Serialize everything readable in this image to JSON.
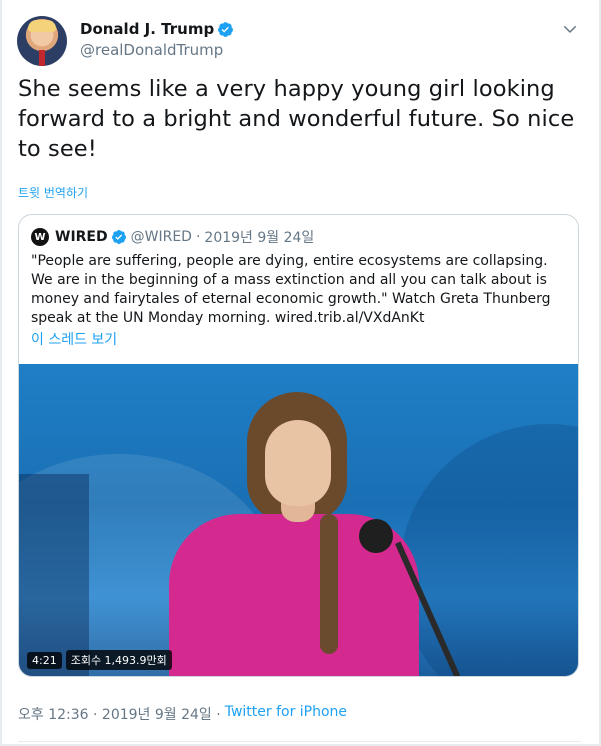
{
  "author": {
    "display_name": "Donald J. Trump",
    "handle": "@realDonaldTrump"
  },
  "tweet": {
    "text": "She seems like a very happy young girl looking forward to a bright and wonderful future. So nice to see!",
    "translate_link": "트윗 번역하기"
  },
  "quote": {
    "name": "WIRED",
    "handle": "@WIRED",
    "separator": "·",
    "date": "2019년 9월 24일",
    "body": "\"People are suffering, people are dying, entire ecosystems are collapsing. We are in the beginning of a mass extinction and all you can talk about is money and fairytales of eternal economic growth.\" Watch Greta Thunberg speak at the UN Monday morning. wired.trib.al/VXdAnKt",
    "thread_link": "이 스레드 보기",
    "video": {
      "duration": "4:21",
      "views": "조회수 1,493.9만회"
    }
  },
  "meta": {
    "time_date": "오후 12:36 · 2019년 9월 24일 ·",
    "source": "Twitter for iPhone"
  },
  "colors": {
    "link": "#1da1f2",
    "muted": "#657786",
    "text": "#14171a"
  }
}
